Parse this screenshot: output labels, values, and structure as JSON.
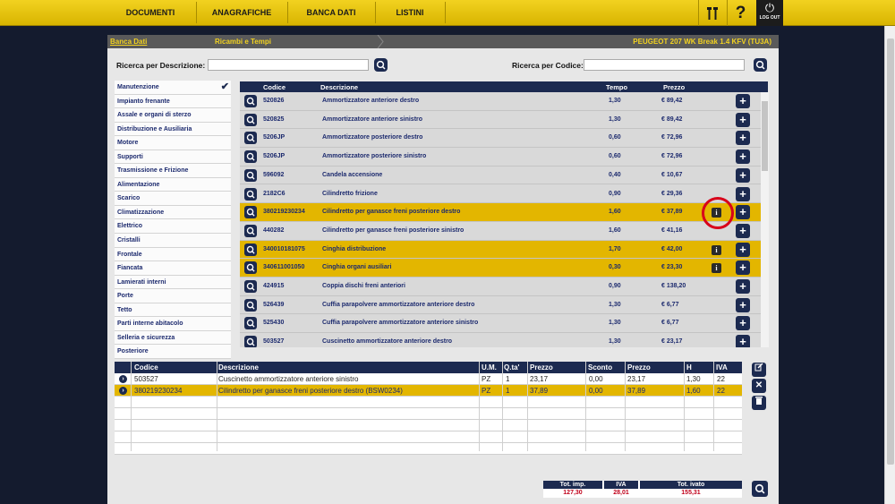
{
  "nav": {
    "items": [
      "DOCUMENTI",
      "ANAGRAFICHE",
      "BANCA DATI",
      "LISTINI"
    ],
    "logout_label": "LOG OUT",
    "help_label": "?"
  },
  "breadcrumb": {
    "link": "Banca Dati",
    "section": "Ricambi e Tempi",
    "vehicle": "PEUGEOT 207 WK Break 1.4 KFV (TU3A)"
  },
  "search": {
    "desc_label": "Ricerca per Descrizione:",
    "code_label": "Ricerca per Codice:",
    "desc_value": "",
    "code_value": ""
  },
  "categories": [
    {
      "label": "Manutenzione",
      "selected": true
    },
    {
      "label": "Impianto frenante",
      "selected": false
    },
    {
      "label": "Assale e organi di sterzo",
      "selected": false
    },
    {
      "label": "Distribuzione e Ausiliaria",
      "selected": false
    },
    {
      "label": "Motore",
      "selected": false
    },
    {
      "label": "Supporti",
      "selected": false
    },
    {
      "label": "Trasmissione e Frizione",
      "selected": false
    },
    {
      "label": "Alimentazione",
      "selected": false
    },
    {
      "label": "Scarico",
      "selected": false
    },
    {
      "label": "Climatizzazione",
      "selected": false
    },
    {
      "label": "Elettrico",
      "selected": false
    },
    {
      "label": "Cristalli",
      "selected": false
    },
    {
      "label": "Frontale",
      "selected": false
    },
    {
      "label": "Fiancata",
      "selected": false
    },
    {
      "label": "Lamierati interni",
      "selected": false
    },
    {
      "label": "Porte",
      "selected": false
    },
    {
      "label": "Tetto",
      "selected": false
    },
    {
      "label": "Parti interne abitacolo",
      "selected": false
    },
    {
      "label": "Selleria e sicurezza",
      "selected": false
    },
    {
      "label": "Posteriore",
      "selected": false
    }
  ],
  "parts": {
    "headers": {
      "code": "Codice",
      "desc": "Descrizione",
      "time": "Tempo",
      "price": "Prezzo"
    },
    "rows": [
      {
        "code": "520826",
        "desc": "Ammortizzatore anteriore destro",
        "time": "1,30",
        "price": "€ 89,42",
        "highlight": false,
        "info": false
      },
      {
        "code": "520825",
        "desc": "Ammortizzatore anteriore sinistro",
        "time": "1,30",
        "price": "€ 89,42",
        "highlight": false,
        "info": false
      },
      {
        "code": "5206JP",
        "desc": "Ammortizzatore posteriore destro",
        "time": "0,60",
        "price": "€ 72,96",
        "highlight": false,
        "info": false
      },
      {
        "code": "5206JP",
        "desc": "Ammortizzatore posteriore sinistro",
        "time": "0,60",
        "price": "€ 72,96",
        "highlight": false,
        "info": false
      },
      {
        "code": "596092",
        "desc": "Candela accensione",
        "time": "0,40",
        "price": "€ 10,67",
        "highlight": false,
        "info": false
      },
      {
        "code": "2182C6",
        "desc": "Cilindretto frizione",
        "time": "0,90",
        "price": "€ 29,36",
        "highlight": false,
        "info": false
      },
      {
        "code": "380219230234",
        "desc": "Cilindretto per ganasce freni posteriore destro",
        "time": "1,60",
        "price": "€ 37,89",
        "highlight": true,
        "info": true
      },
      {
        "code": "440282",
        "desc": "Cilindretto per ganasce freni posteriore sinistro",
        "time": "1,60",
        "price": "€ 41,16",
        "highlight": false,
        "info": false
      },
      {
        "code": "340010181075",
        "desc": "Cinghia distribuzione",
        "time": "1,70",
        "price": "€ 42,00",
        "highlight": true,
        "info": true
      },
      {
        "code": "340611001050",
        "desc": "Cinghia organi ausiliari",
        "time": "0,30",
        "price": "€ 23,30",
        "highlight": true,
        "info": true
      },
      {
        "code": "424915",
        "desc": "Coppia dischi freni anteriori",
        "time": "0,90",
        "price": "€ 138,20",
        "highlight": false,
        "info": false
      },
      {
        "code": "526439",
        "desc": "Cuffia parapolvere ammortizzatore anteriore destro",
        "time": "1,30",
        "price": "€ 6,77",
        "highlight": false,
        "info": false
      },
      {
        "code": "525430",
        "desc": "Cuffia parapolvere ammortizzatore anteriore sinistro",
        "time": "1,30",
        "price": "€ 6,77",
        "highlight": false,
        "info": false
      },
      {
        "code": "503527",
        "desc": "Cuscinetto ammortizzatore anteriore destro",
        "time": "1,30",
        "price": "€ 23,17",
        "highlight": false,
        "info": false
      }
    ]
  },
  "cart": {
    "headers": {
      "code": "Codice",
      "desc": "Descrizione",
      "um": "U.M.",
      "qty": "Q.ta'",
      "price": "Prezzo",
      "discount": "Sconto",
      "net": "Prezzo",
      "h": "H",
      "iva": "IVA"
    },
    "rows": [
      {
        "code": "503527",
        "desc": "Cuscinetto ammortizzatore anteriore sinistro",
        "um": "PZ",
        "qty": "1",
        "price": "23,17",
        "discount": "0,00",
        "net": "23,17",
        "h": "1,30",
        "iva": "22",
        "highlight": false
      },
      {
        "code": "380219230234",
        "desc": "Cilindretto per ganasce freni posteriore destro (BSW0234)",
        "um": "PZ",
        "qty": "1",
        "price": "37,89",
        "discount": "0,00",
        "net": "37,89",
        "h": "1,60",
        "iva": "22",
        "highlight": true
      }
    ]
  },
  "totals": {
    "imp_label": "Tot. imp.",
    "iva_label": "IVA",
    "ivato_label": "Tot. ivato",
    "imp": "127,30",
    "iva": "28,01",
    "ivato": "155,31"
  },
  "colors": {
    "accent_yellow": "#e3b600",
    "navy": "#1c2a50",
    "annotation_red": "#d8001a"
  }
}
